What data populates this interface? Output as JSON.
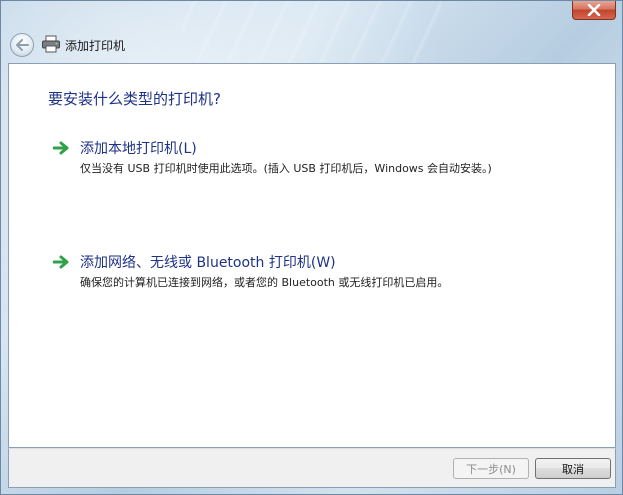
{
  "window": {
    "title": "添加打印机"
  },
  "icons": {
    "close": "close-icon",
    "back": "back-arrow-icon",
    "printer": "printer-icon",
    "option_arrow": "green-arrow-icon"
  },
  "colors": {
    "link_blue": "#1e3287",
    "close_red": "#c4432c",
    "arrow_green": "#2ea24a"
  },
  "content": {
    "question": "要安装什么类型的打印机?",
    "options": [
      {
        "title": "添加本地打印机(L)",
        "description": "仅当没有 USB 打印机时使用此选项。(插入 USB 打印机后，Windows 会自动安装。)"
      },
      {
        "title": "添加网络、无线或 Bluetooth 打印机(W)",
        "description": "确保您的计算机已连接到网络，或者您的 Bluetooth 或无线打印机已启用。"
      }
    ]
  },
  "footer": {
    "next_label": "下一步(N)",
    "cancel_label": "取消"
  }
}
